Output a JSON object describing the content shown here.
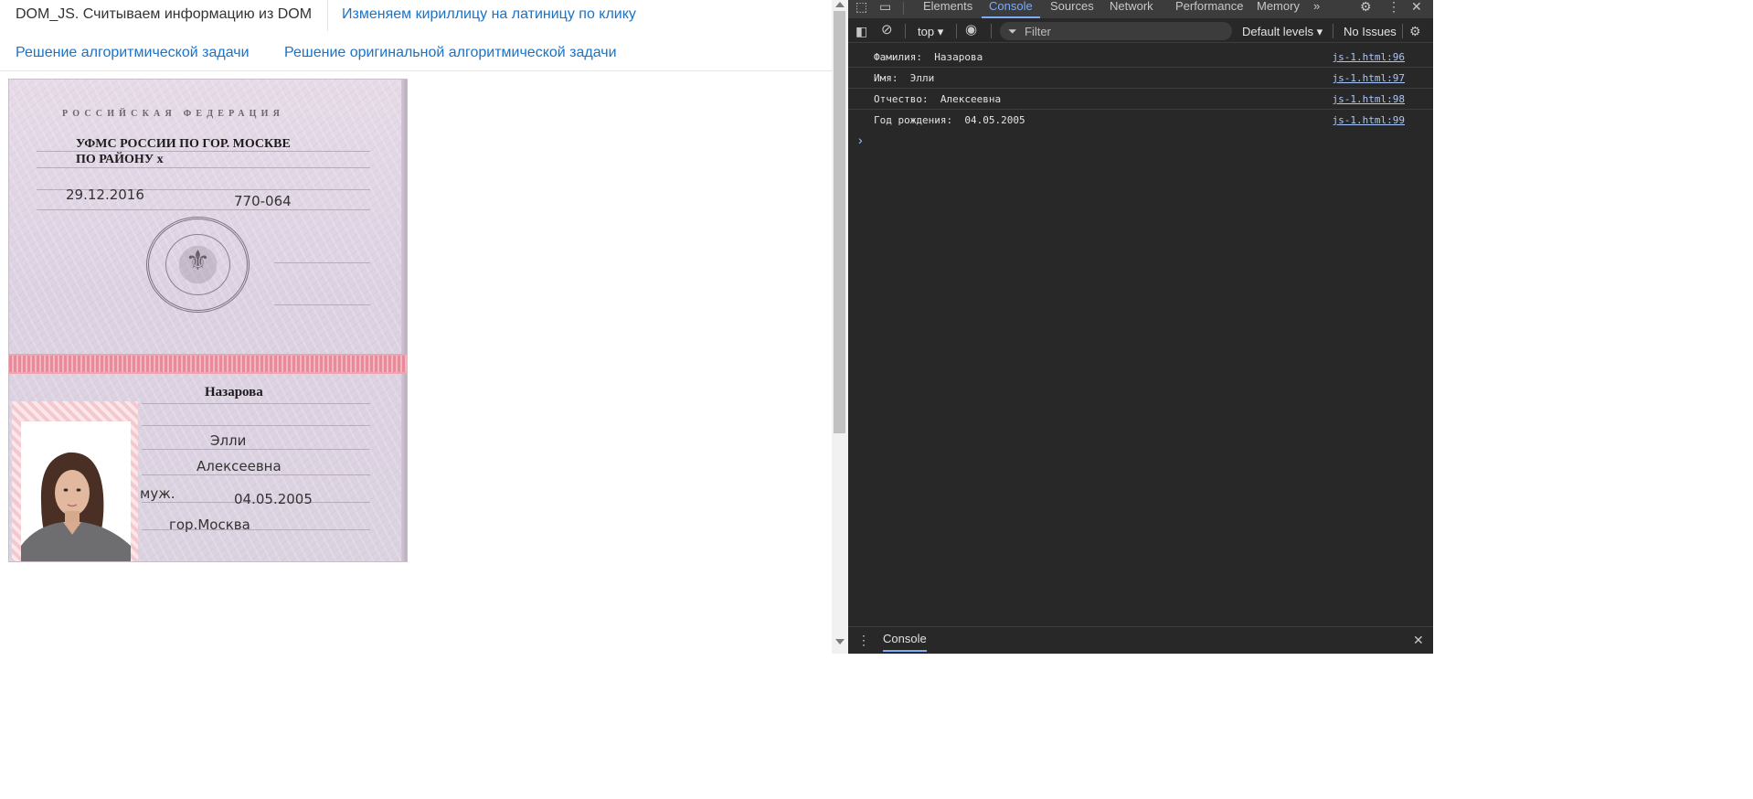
{
  "page": {
    "tabs_row1": [
      {
        "label": "DOM_JS. Считываем информацию из DOM"
      },
      {
        "label": "Изменяем кириллицу на латиницу по клику"
      }
    ],
    "tabs_row2": [
      {
        "label": "Решение алгоритмической задачи"
      },
      {
        "label": "Решение оригинальной алгоритмической задачи"
      }
    ],
    "passport": {
      "header": "РОССИЙСКАЯ ФЕДЕРАЦИЯ",
      "issuer_line1": "УФМС РОССИИ ПО ГОР. МОСКВЕ",
      "issuer_line2": "ПО РАЙОНУ х",
      "issue_date": "29.12.2016",
      "department_code": "770-064",
      "surname": "Назарова",
      "first_name": "Элли",
      "patronymic": "Алексеевна",
      "sex": "муж.",
      "birth_date": "04.05.2005",
      "birth_place": "гор.Москва"
    }
  },
  "devtools": {
    "tabs": [
      {
        "label": "Elements"
      },
      {
        "label": "Console"
      },
      {
        "label": "Sources"
      },
      {
        "label": "Network"
      },
      {
        "label": "Performance"
      },
      {
        "label": "Memory"
      }
    ],
    "more_tabs": "»",
    "active_tab": "Console",
    "toolbar": {
      "context": "top",
      "filter_placeholder": "Filter",
      "levels": "Default levels",
      "issues": "No Issues"
    },
    "console_rows": [
      {
        "message": "Фамилия:  Назарова",
        "source": "js-1.html:96"
      },
      {
        "message": "Имя:  Элли",
        "source": "js-1.html:97"
      },
      {
        "message": "Отчество:  Алексеевна",
        "source": "js-1.html:98"
      },
      {
        "message": "Год рождения:  04.05.2005",
        "source": "js-1.html:99"
      }
    ],
    "prompt_symbol": "›",
    "drawer_tab": "Console"
  }
}
